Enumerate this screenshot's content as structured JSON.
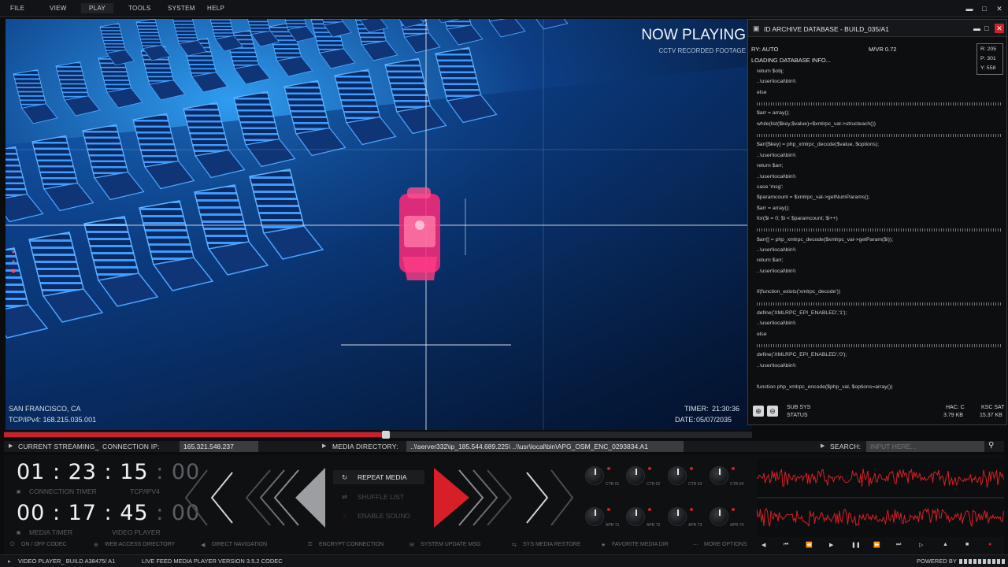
{
  "menubar": {
    "items": [
      "FILE",
      "VIEW",
      "PLAY",
      "TOOLS",
      "SYSTEM",
      "HELP"
    ],
    "active": "PLAY"
  },
  "video": {
    "now_playing": "NOW PLAYING",
    "subtitle": "CCTV RECORDED FOOTAGE",
    "location": "SAN FRANCISCO, CA",
    "ip": "TCP/IPv4: 168.215.035.001",
    "timer_label": "TIMER:",
    "timer_value": "21:30:36",
    "date_label": "DATE:",
    "date_value": "05/07/2035",
    "progress": 0.51
  },
  "db_panel": {
    "title": "ID ARCHIVE DATABASE - BUILD_035/A1",
    "ry": "RY: AUTO",
    "mvr": "M/VR 0.72",
    "loading": "LOADING DATABASE INFO...",
    "coords": [
      "R: 205",
      "P: 301",
      "Y: 558"
    ],
    "code": [
      "return $obj;",
      "..\\user\\local\\bin\\\\",
      "else",
      "---",
      "$arr = array();",
      "while(list($key,$value)=$xmlrpc_val->structeach())",
      "---",
      "$arr[$key] = php_xmlrpc_decode($value, $options);",
      "..\\user\\local\\bin\\\\",
      "return $arr;",
      "..\\user\\local\\bin\\\\",
      "case 'msg':",
      "$paramcount = $xmlrpc_val->getNumParams();",
      "$arr = array();",
      "for($i = 0; $i < $paramcount; $i++)",
      "---",
      "$arr[] = php_xmlrpc_decode($xmlrpc_val->getParam($i));",
      "..\\user\\local\\bin\\\\",
      "return $arr;",
      "..\\user\\local\\bin\\\\",
      "",
      "if(function_exists('xmlrpc_decode'))",
      "---",
      "define('XMLRPC_EPI_ENABLED','1');",
      "..\\user\\local\\bin\\\\",
      "else",
      "---",
      "define('XMLRPC_EPI_ENABLED','0');",
      "..\\user\\local\\bin\\\\",
      "",
      "function php_xmlrpc_encode($php_val, $options=array())"
    ],
    "footer": {
      "sub_sys": "SUB SYS",
      "status": "STATUS",
      "hac": "HAC: C",
      "hac_size": "3.79 KB",
      "ksc": "KSC SAT",
      "ksc_size": "15.37 KB"
    }
  },
  "infobar": {
    "current_streaming": "CURRENT STREAMING_",
    "connection_ip_label": "CONNECTION IP:",
    "connection_ip": "165.321.548.237",
    "media_dir_label": "MEDIA DIRECTORY:",
    "media_dir": "..\\\\server332\\ip_185.544.689.225\\  ..\\\\usr\\local\\bin\\APG_OSM_ENC_0293834.A1",
    "search_label": "SEARCH:",
    "search_placeholder": "INPUT HERE..."
  },
  "timers": {
    "conn_time": "01 : 23 : 15",
    "conn_frac": ": 00",
    "conn_label": "CONNECTION TIMER",
    "conn_proto": "TCP/IPV4",
    "media_time": "00 : 17 : 45",
    "media_frac": ": 00",
    "media_label": "MEDIA TIMER",
    "media_player": "VIDEO PLAYER"
  },
  "options": {
    "repeat": "REPEAT MEDIA",
    "shuffle": "SHUFFLE LIST",
    "sound": "ENABLE SOUND"
  },
  "knobs": [
    "CTR 01",
    "CTR 02",
    "CTR 03",
    "CTR 04",
    "APR T1",
    "APR T2",
    "APR T3",
    "APR T4"
  ],
  "bottom_items": [
    "ON / OFF CODEC",
    "WEB ACCESS DIRECTORY",
    "DIRECT NAVIGATION",
    "ENCRYPT CONNECTION",
    "SYSTEM UPDATE MSG",
    "SYS MEDIA RESTORE",
    "FAVORITE MEDIA DIR",
    "MORE OPTIONS"
  ],
  "statusbar": {
    "left": "VIDEO PLAYER_ BUILD A38475/ A1",
    "center": "LIVE FEED MEDIA PLAYER VERSION 3.5.2 CODEC",
    "right": "POWERED BY"
  },
  "colors": {
    "accent": "#d61f26",
    "scene": "#1f6fd8",
    "target": "#ff2a7a"
  }
}
